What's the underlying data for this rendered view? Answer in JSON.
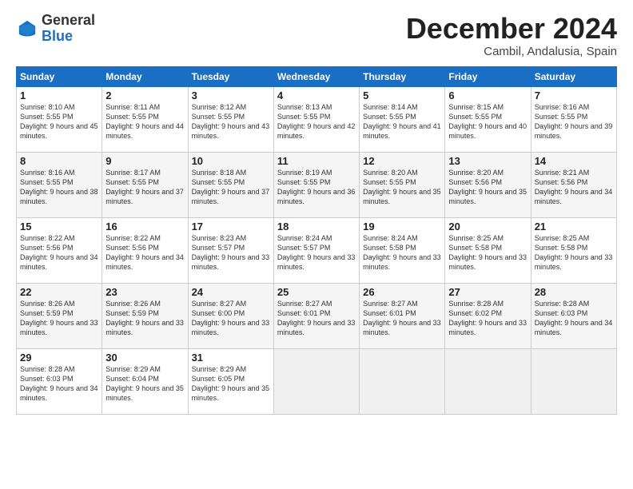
{
  "logo": {
    "general": "General",
    "blue": "Blue"
  },
  "header": {
    "month": "December 2024",
    "location": "Cambil, Andalusia, Spain"
  },
  "days_of_week": [
    "Sunday",
    "Monday",
    "Tuesday",
    "Wednesday",
    "Thursday",
    "Friday",
    "Saturday"
  ],
  "weeks": [
    [
      {
        "day": "1",
        "sunrise": "Sunrise: 8:10 AM",
        "sunset": "Sunset: 5:55 PM",
        "daylight": "Daylight: 9 hours and 45 minutes."
      },
      {
        "day": "2",
        "sunrise": "Sunrise: 8:11 AM",
        "sunset": "Sunset: 5:55 PM",
        "daylight": "Daylight: 9 hours and 44 minutes."
      },
      {
        "day": "3",
        "sunrise": "Sunrise: 8:12 AM",
        "sunset": "Sunset: 5:55 PM",
        "daylight": "Daylight: 9 hours and 43 minutes."
      },
      {
        "day": "4",
        "sunrise": "Sunrise: 8:13 AM",
        "sunset": "Sunset: 5:55 PM",
        "daylight": "Daylight: 9 hours and 42 minutes."
      },
      {
        "day": "5",
        "sunrise": "Sunrise: 8:14 AM",
        "sunset": "Sunset: 5:55 PM",
        "daylight": "Daylight: 9 hours and 41 minutes."
      },
      {
        "day": "6",
        "sunrise": "Sunrise: 8:15 AM",
        "sunset": "Sunset: 5:55 PM",
        "daylight": "Daylight: 9 hours and 40 minutes."
      },
      {
        "day": "7",
        "sunrise": "Sunrise: 8:16 AM",
        "sunset": "Sunset: 5:55 PM",
        "daylight": "Daylight: 9 hours and 39 minutes."
      }
    ],
    [
      {
        "day": "8",
        "sunrise": "Sunrise: 8:16 AM",
        "sunset": "Sunset: 5:55 PM",
        "daylight": "Daylight: 9 hours and 38 minutes."
      },
      {
        "day": "9",
        "sunrise": "Sunrise: 8:17 AM",
        "sunset": "Sunset: 5:55 PM",
        "daylight": "Daylight: 9 hours and 37 minutes."
      },
      {
        "day": "10",
        "sunrise": "Sunrise: 8:18 AM",
        "sunset": "Sunset: 5:55 PM",
        "daylight": "Daylight: 9 hours and 37 minutes."
      },
      {
        "day": "11",
        "sunrise": "Sunrise: 8:19 AM",
        "sunset": "Sunset: 5:55 PM",
        "daylight": "Daylight: 9 hours and 36 minutes."
      },
      {
        "day": "12",
        "sunrise": "Sunrise: 8:20 AM",
        "sunset": "Sunset: 5:55 PM",
        "daylight": "Daylight: 9 hours and 35 minutes."
      },
      {
        "day": "13",
        "sunrise": "Sunrise: 8:20 AM",
        "sunset": "Sunset: 5:56 PM",
        "daylight": "Daylight: 9 hours and 35 minutes."
      },
      {
        "day": "14",
        "sunrise": "Sunrise: 8:21 AM",
        "sunset": "Sunset: 5:56 PM",
        "daylight": "Daylight: 9 hours and 34 minutes."
      }
    ],
    [
      {
        "day": "15",
        "sunrise": "Sunrise: 8:22 AM",
        "sunset": "Sunset: 5:56 PM",
        "daylight": "Daylight: 9 hours and 34 minutes."
      },
      {
        "day": "16",
        "sunrise": "Sunrise: 8:22 AM",
        "sunset": "Sunset: 5:56 PM",
        "daylight": "Daylight: 9 hours and 34 minutes."
      },
      {
        "day": "17",
        "sunrise": "Sunrise: 8:23 AM",
        "sunset": "Sunset: 5:57 PM",
        "daylight": "Daylight: 9 hours and 33 minutes."
      },
      {
        "day": "18",
        "sunrise": "Sunrise: 8:24 AM",
        "sunset": "Sunset: 5:57 PM",
        "daylight": "Daylight: 9 hours and 33 minutes."
      },
      {
        "day": "19",
        "sunrise": "Sunrise: 8:24 AM",
        "sunset": "Sunset: 5:58 PM",
        "daylight": "Daylight: 9 hours and 33 minutes."
      },
      {
        "day": "20",
        "sunrise": "Sunrise: 8:25 AM",
        "sunset": "Sunset: 5:58 PM",
        "daylight": "Daylight: 9 hours and 33 minutes."
      },
      {
        "day": "21",
        "sunrise": "Sunrise: 8:25 AM",
        "sunset": "Sunset: 5:58 PM",
        "daylight": "Daylight: 9 hours and 33 minutes."
      }
    ],
    [
      {
        "day": "22",
        "sunrise": "Sunrise: 8:26 AM",
        "sunset": "Sunset: 5:59 PM",
        "daylight": "Daylight: 9 hours and 33 minutes."
      },
      {
        "day": "23",
        "sunrise": "Sunrise: 8:26 AM",
        "sunset": "Sunset: 5:59 PM",
        "daylight": "Daylight: 9 hours and 33 minutes."
      },
      {
        "day": "24",
        "sunrise": "Sunrise: 8:27 AM",
        "sunset": "Sunset: 6:00 PM",
        "daylight": "Daylight: 9 hours and 33 minutes."
      },
      {
        "day": "25",
        "sunrise": "Sunrise: 8:27 AM",
        "sunset": "Sunset: 6:01 PM",
        "daylight": "Daylight: 9 hours and 33 minutes."
      },
      {
        "day": "26",
        "sunrise": "Sunrise: 8:27 AM",
        "sunset": "Sunset: 6:01 PM",
        "daylight": "Daylight: 9 hours and 33 minutes."
      },
      {
        "day": "27",
        "sunrise": "Sunrise: 8:28 AM",
        "sunset": "Sunset: 6:02 PM",
        "daylight": "Daylight: 9 hours and 33 minutes."
      },
      {
        "day": "28",
        "sunrise": "Sunrise: 8:28 AM",
        "sunset": "Sunset: 6:03 PM",
        "daylight": "Daylight: 9 hours and 34 minutes."
      }
    ],
    [
      {
        "day": "29",
        "sunrise": "Sunrise: 8:28 AM",
        "sunset": "Sunset: 6:03 PM",
        "daylight": "Daylight: 9 hours and 34 minutes."
      },
      {
        "day": "30",
        "sunrise": "Sunrise: 8:29 AM",
        "sunset": "Sunset: 6:04 PM",
        "daylight": "Daylight: 9 hours and 35 minutes."
      },
      {
        "day": "31",
        "sunrise": "Sunrise: 8:29 AM",
        "sunset": "Sunset: 6:05 PM",
        "daylight": "Daylight: 9 hours and 35 minutes."
      },
      null,
      null,
      null,
      null
    ]
  ]
}
